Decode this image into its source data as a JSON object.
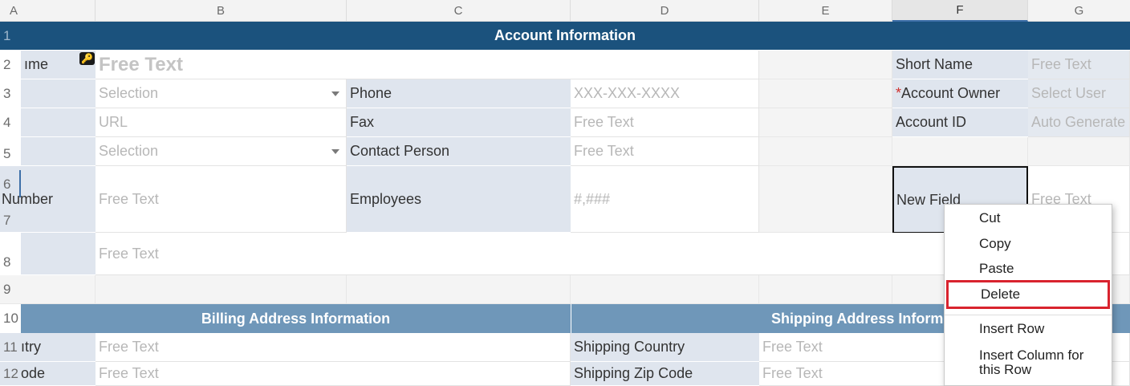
{
  "columns": [
    "A",
    "B",
    "C",
    "D",
    "E",
    "F",
    "G"
  ],
  "selected_column": "F",
  "rows": [
    "1",
    "2",
    "3",
    "4",
    "5",
    "6",
    "7",
    "8",
    "9",
    "10",
    "11",
    "12"
  ],
  "header": {
    "title": "Account Information"
  },
  "account": {
    "name_label": "ıme",
    "name_value": "Free Text",
    "row3_value": "Selection",
    "phone_label": "Phone",
    "phone_value": "XXX-XXX-XXXX",
    "row4_value": "URL",
    "fax_label": "Fax",
    "fax_value": "Free Text",
    "row5_value": "Selection",
    "contact_label": "Contact Person",
    "contact_value": "Free Text",
    "number_label": "Number",
    "number_value": "Free Text",
    "employees_label": "Employees",
    "employees_value": "#,###",
    "short_name_label": "Short Name",
    "short_name_value": "Free Text",
    "owner_required": "*",
    "owner_label": "Account Owner",
    "owner_value": "Select User",
    "account_id_label": "Account ID",
    "account_id_value": "Auto Generate",
    "new_field_label": "New Field",
    "new_field_value": "Free Text",
    "row8_value": "Free Text"
  },
  "billing": {
    "title": "Billing Address Information",
    "row11_label": "ıtry",
    "row11_value": "Free Text",
    "row12_label": "ode",
    "row12_value": "Free Text"
  },
  "shipping": {
    "title": "Shipping Address Inform",
    "country_label": "Shipping Country",
    "country_value": "Free Text",
    "zip_label": "Shipping Zip Code",
    "zip_value": "Free Text"
  },
  "context_menu": {
    "cut": "Cut",
    "copy": "Copy",
    "paste": "Paste",
    "delete": "Delete",
    "insert_row": "Insert Row",
    "insert_column_1": "Insert Column for",
    "insert_column_2": "this Row"
  },
  "colors": {
    "header_bar": "#1b527d",
    "section_bar": "#6f97b9",
    "label_bg": "#dfe5ee",
    "highlight": "#d9232e"
  },
  "icons": {
    "lock": "key-icon",
    "dropdown": "chevron-down-icon"
  }
}
